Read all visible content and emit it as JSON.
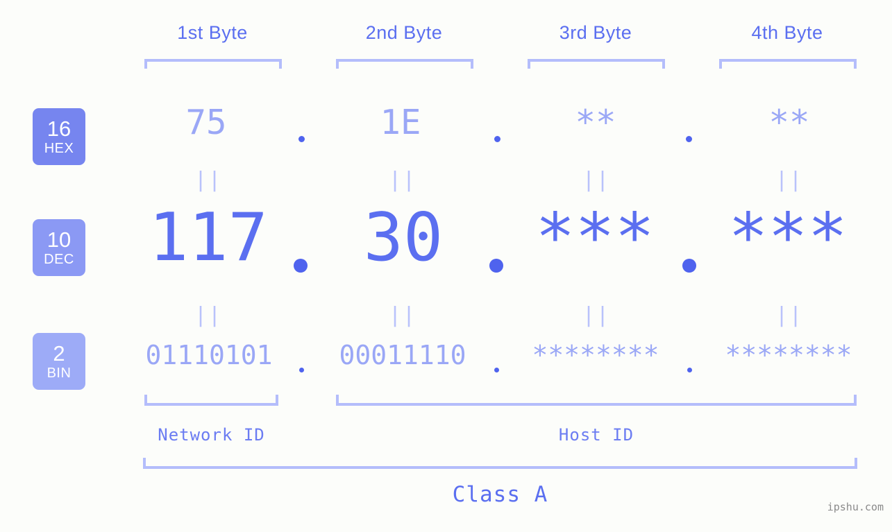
{
  "background_color": "#fcfdfa",
  "accent_color": "#5b6ff0",
  "muted_color": "#9aa7f6",
  "bracket_color": "#b4bdfb",
  "byte_headers": [
    {
      "label": "1st Byte"
    },
    {
      "label": "2nd Byte"
    },
    {
      "label": "3rd Byte"
    },
    {
      "label": "4th Byte"
    }
  ],
  "radix_rows": [
    {
      "badge_number": "16",
      "badge_name": "HEX",
      "badge_color": "#7685ef",
      "values": [
        "75",
        "1E",
        "**",
        "**"
      ],
      "separator": "."
    },
    {
      "badge_number": "10",
      "badge_name": "DEC",
      "badge_color": "#8b99f4",
      "values": [
        "117",
        "30",
        "***",
        "***"
      ],
      "separator": "."
    },
    {
      "badge_number": "2",
      "badge_name": "BIN",
      "badge_color": "#9dabf7",
      "values": [
        "01110101",
        "00011110",
        "********",
        "********"
      ],
      "separator": "."
    }
  ],
  "equality_mark": "||",
  "id_sections": [
    {
      "label": "Network ID"
    },
    {
      "label": "Host ID"
    }
  ],
  "class_label": "Class A",
  "watermark": "ipshu.com"
}
